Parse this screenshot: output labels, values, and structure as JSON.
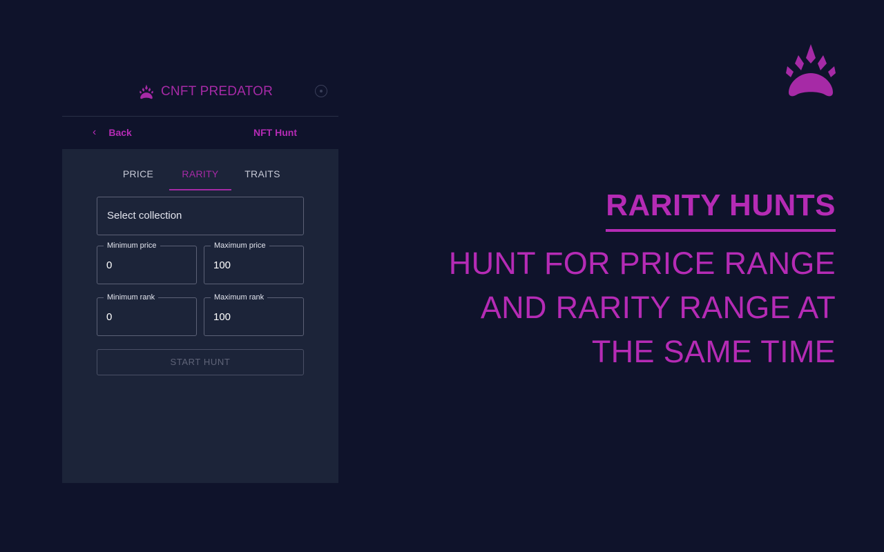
{
  "app": {
    "name": "CNFT PREDATOR",
    "brand_color": "#a62aa6",
    "logo_icon": "paw-icon",
    "settings_icon": "settings-icon"
  },
  "nav": {
    "back_label": "Back",
    "back_icon": "chevron-left-icon",
    "title": "NFT Hunt"
  },
  "tabs": [
    {
      "label": "PRICE",
      "active": false
    },
    {
      "label": "RARITY",
      "active": true
    },
    {
      "label": "TRAITS",
      "active": false
    }
  ],
  "form": {
    "collection_placeholder": "Select collection",
    "min_price": {
      "label": "Minimum price",
      "value": "0"
    },
    "max_price": {
      "label": "Maximum price",
      "value": "100"
    },
    "min_rank": {
      "label": "Minimum rank",
      "value": "0"
    },
    "max_rank": {
      "label": "Maximum rank",
      "value": "100"
    },
    "start_label": "START HUNT"
  },
  "promo": {
    "headline": "RARITY HUNTS",
    "tagline_lines": [
      "HUNT FOR PRICE RANGE",
      "AND RARITY RANGE AT",
      "THE SAME TIME"
    ],
    "accent_color": "#b52bb5",
    "background_color": "#0f132b"
  }
}
